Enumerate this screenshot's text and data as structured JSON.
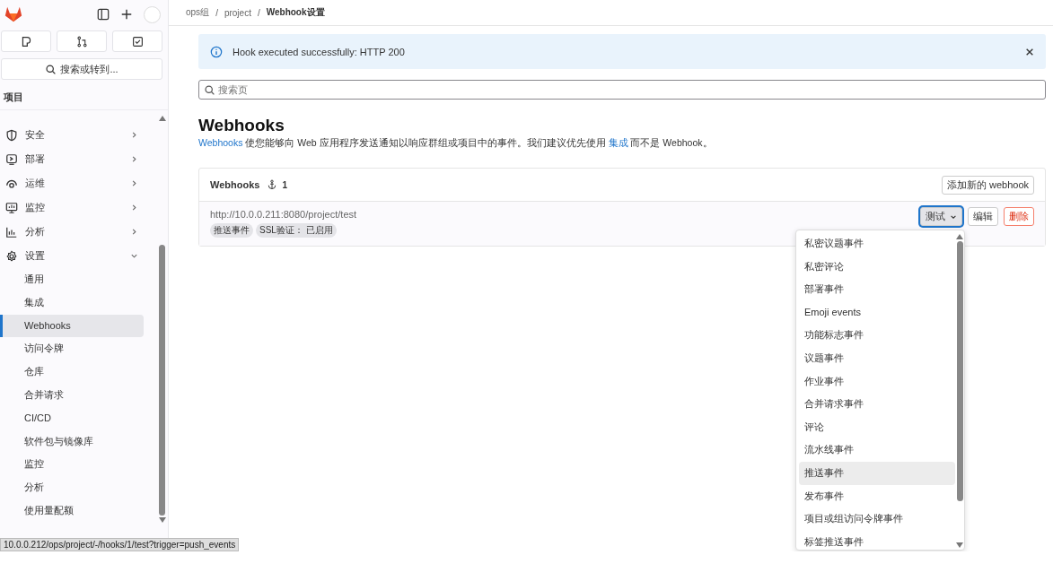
{
  "sidebar": {
    "search": "搜索或转到...",
    "section_title": "项目",
    "groups": [
      {
        "label": "安全",
        "expanded": false
      },
      {
        "label": "部署",
        "expanded": false
      },
      {
        "label": "运维",
        "expanded": false
      },
      {
        "label": "监控",
        "expanded": false
      },
      {
        "label": "分析",
        "expanded": false
      },
      {
        "label": "设置",
        "expanded": true,
        "children": [
          {
            "label": "通用",
            "selected": false
          },
          {
            "label": "集成",
            "selected": false
          },
          {
            "label": "Webhooks",
            "selected": true
          },
          {
            "label": "访问令牌",
            "selected": false
          },
          {
            "label": "仓库",
            "selected": false
          },
          {
            "label": "合并请求",
            "selected": false
          },
          {
            "label": "CI/CD",
            "selected": false
          },
          {
            "label": "软件包与镜像库",
            "selected": false
          },
          {
            "label": "监控",
            "selected": false
          },
          {
            "label": "分析",
            "selected": false
          },
          {
            "label": "使用量配额",
            "selected": false
          }
        ]
      }
    ]
  },
  "breadcrumbs": [
    "ops组",
    "project",
    "Webhook设置"
  ],
  "breadcrumb_separators": [
    "/",
    "/"
  ],
  "alert": {
    "message": "Hook executed successfully: HTTP 200"
  },
  "page_search": {
    "placeholder": "搜索页"
  },
  "heading": "Webhooks",
  "description": {
    "link": "Webhooks",
    "text1": " 使您能够向 Web 应用程序发送通知以响应群组或项目中的事件。我们建议优先使用 ",
    "link2": "集成",
    "text2": " 而不是 Webhook。"
  },
  "webhooks_card": {
    "title": "Webhooks",
    "count": "1",
    "add_button": "添加新的 webhook",
    "hooks": [
      {
        "url": "http://10.0.0.211:8080/project/test",
        "badges": [
          "推送事件",
          "SSL验证： 已启用"
        ],
        "test_button": "测试",
        "edit_button": "编辑",
        "delete_button": "删除"
      }
    ]
  },
  "test_menu": {
    "items": [
      {
        "label": "私密议题事件",
        "selected": false
      },
      {
        "label": "私密评论",
        "selected": false
      },
      {
        "label": "部署事件",
        "selected": false
      },
      {
        "label": "Emoji events",
        "selected": false
      },
      {
        "label": "功能标志事件",
        "selected": false
      },
      {
        "label": "议题事件",
        "selected": false
      },
      {
        "label": "作业事件",
        "selected": false
      },
      {
        "label": "合并请求事件",
        "selected": false
      },
      {
        "label": "评论",
        "selected": false
      },
      {
        "label": "流水线事件",
        "selected": false
      },
      {
        "label": "推送事件",
        "selected": true
      },
      {
        "label": "发布事件",
        "selected": false
      },
      {
        "label": "项目或组访问令牌事件",
        "selected": false
      },
      {
        "label": "标签推送事件",
        "selected": false
      }
    ]
  },
  "status_url": "10.0.0.212/ops/project/-/hooks/1/test?trigger=push_events"
}
